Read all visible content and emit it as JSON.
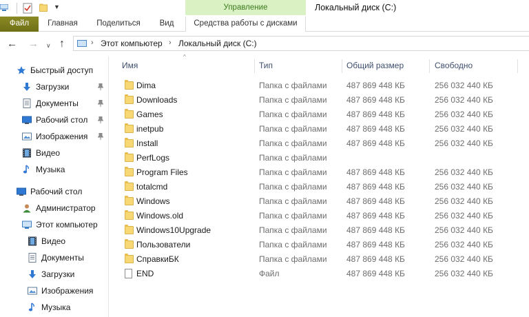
{
  "titlebar": {
    "context_group": "Управление",
    "window_title": "Локальный диск (C:)"
  },
  "ribbon": {
    "tabs": {
      "file": "Файл",
      "home": "Главная",
      "share": "Поделиться",
      "view": "Вид",
      "disk_tools": "Средства работы с дисками"
    }
  },
  "address": {
    "crumbs": [
      "Этот компьютер",
      "Локальный диск (C:)"
    ]
  },
  "navpane": {
    "quick_access": "Быстрый доступ",
    "qa_items": [
      "Загрузки",
      "Документы",
      "Рабочий стол",
      "Изображения",
      "Видео",
      "Музыка"
    ],
    "desktop": "Рабочий стол",
    "admin": "Администратор",
    "this_pc": "Этот компьютер",
    "pc_items": [
      "Видео",
      "Документы",
      "Загрузки",
      "Изображения",
      "Музыка"
    ]
  },
  "columns": {
    "name": "Имя",
    "type": "Тип",
    "total": "Общий размер",
    "free": "Свободно"
  },
  "rows": [
    {
      "name": "Dima",
      "type": "Папка с файлами",
      "total": "487 869 448 КБ",
      "free": "256 032 440 КБ",
      "icon": "folder-icon"
    },
    {
      "name": "Downloads",
      "type": "Папка с файлами",
      "total": "487 869 448 КБ",
      "free": "256 032 440 КБ",
      "icon": "folder-icon"
    },
    {
      "name": "Games",
      "type": "Папка с файлами",
      "total": "487 869 448 КБ",
      "free": "256 032 440 КБ",
      "icon": "folder-icon"
    },
    {
      "name": "inetpub",
      "type": "Папка с файлами",
      "total": "487 869 448 КБ",
      "free": "256 032 440 КБ",
      "icon": "folder-icon"
    },
    {
      "name": "Install",
      "type": "Папка с файлами",
      "total": "487 869 448 КБ",
      "free": "256 032 440 КБ",
      "icon": "folder-icon"
    },
    {
      "name": "PerfLogs",
      "type": "Папка с файлами",
      "total": "",
      "free": "",
      "icon": "folder-icon"
    },
    {
      "name": "Program Files",
      "type": "Папка с файлами",
      "total": "487 869 448 КБ",
      "free": "256 032 440 КБ",
      "icon": "folder-icon"
    },
    {
      "name": "totalcmd",
      "type": "Папка с файлами",
      "total": "487 869 448 КБ",
      "free": "256 032 440 КБ",
      "icon": "folder-icon"
    },
    {
      "name": "Windows",
      "type": "Папка с файлами",
      "total": "487 869 448 КБ",
      "free": "256 032 440 КБ",
      "icon": "folder-icon"
    },
    {
      "name": "Windows.old",
      "type": "Папка с файлами",
      "total": "487 869 448 КБ",
      "free": "256 032 440 КБ",
      "icon": "folder-icon"
    },
    {
      "name": "Windows10Upgrade",
      "type": "Папка с файлами",
      "total": "487 869 448 КБ",
      "free": "256 032 440 КБ",
      "icon": "folder-icon"
    },
    {
      "name": "Пользователи",
      "type": "Папка с файлами",
      "total": "487 869 448 КБ",
      "free": "256 032 440 КБ",
      "icon": "folder-icon"
    },
    {
      "name": "СправкиБК",
      "type": "Папка с файлами",
      "total": "487 869 448 КБ",
      "free": "256 032 440 КБ",
      "icon": "folder-icon"
    },
    {
      "name": "END",
      "type": "Файл",
      "total": "487 869 448 КБ",
      "free": "256 032 440 КБ",
      "icon": "file-icon"
    }
  ],
  "colors": {
    "file_tab": "#7b7a1e",
    "context_header_bg": "#d9f1c3",
    "context_header_text": "#3c7a1e",
    "column_header_text": "#3e4e6e",
    "folder": "#f8d775"
  }
}
